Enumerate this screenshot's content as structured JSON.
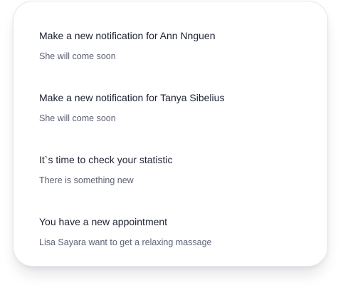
{
  "notifications": [
    {
      "title": "Make a new notification for Ann Nnguen",
      "description": "She will come soon"
    },
    {
      "title": "Make a new notification for Tanya Sibelius",
      "description": "She will come soon"
    },
    {
      "title": "It`s time to check your statistic",
      "description": "There is something new"
    },
    {
      "title": "You have a new appointment",
      "description": "Lisa Sayara want to get a relaxing massage"
    }
  ]
}
